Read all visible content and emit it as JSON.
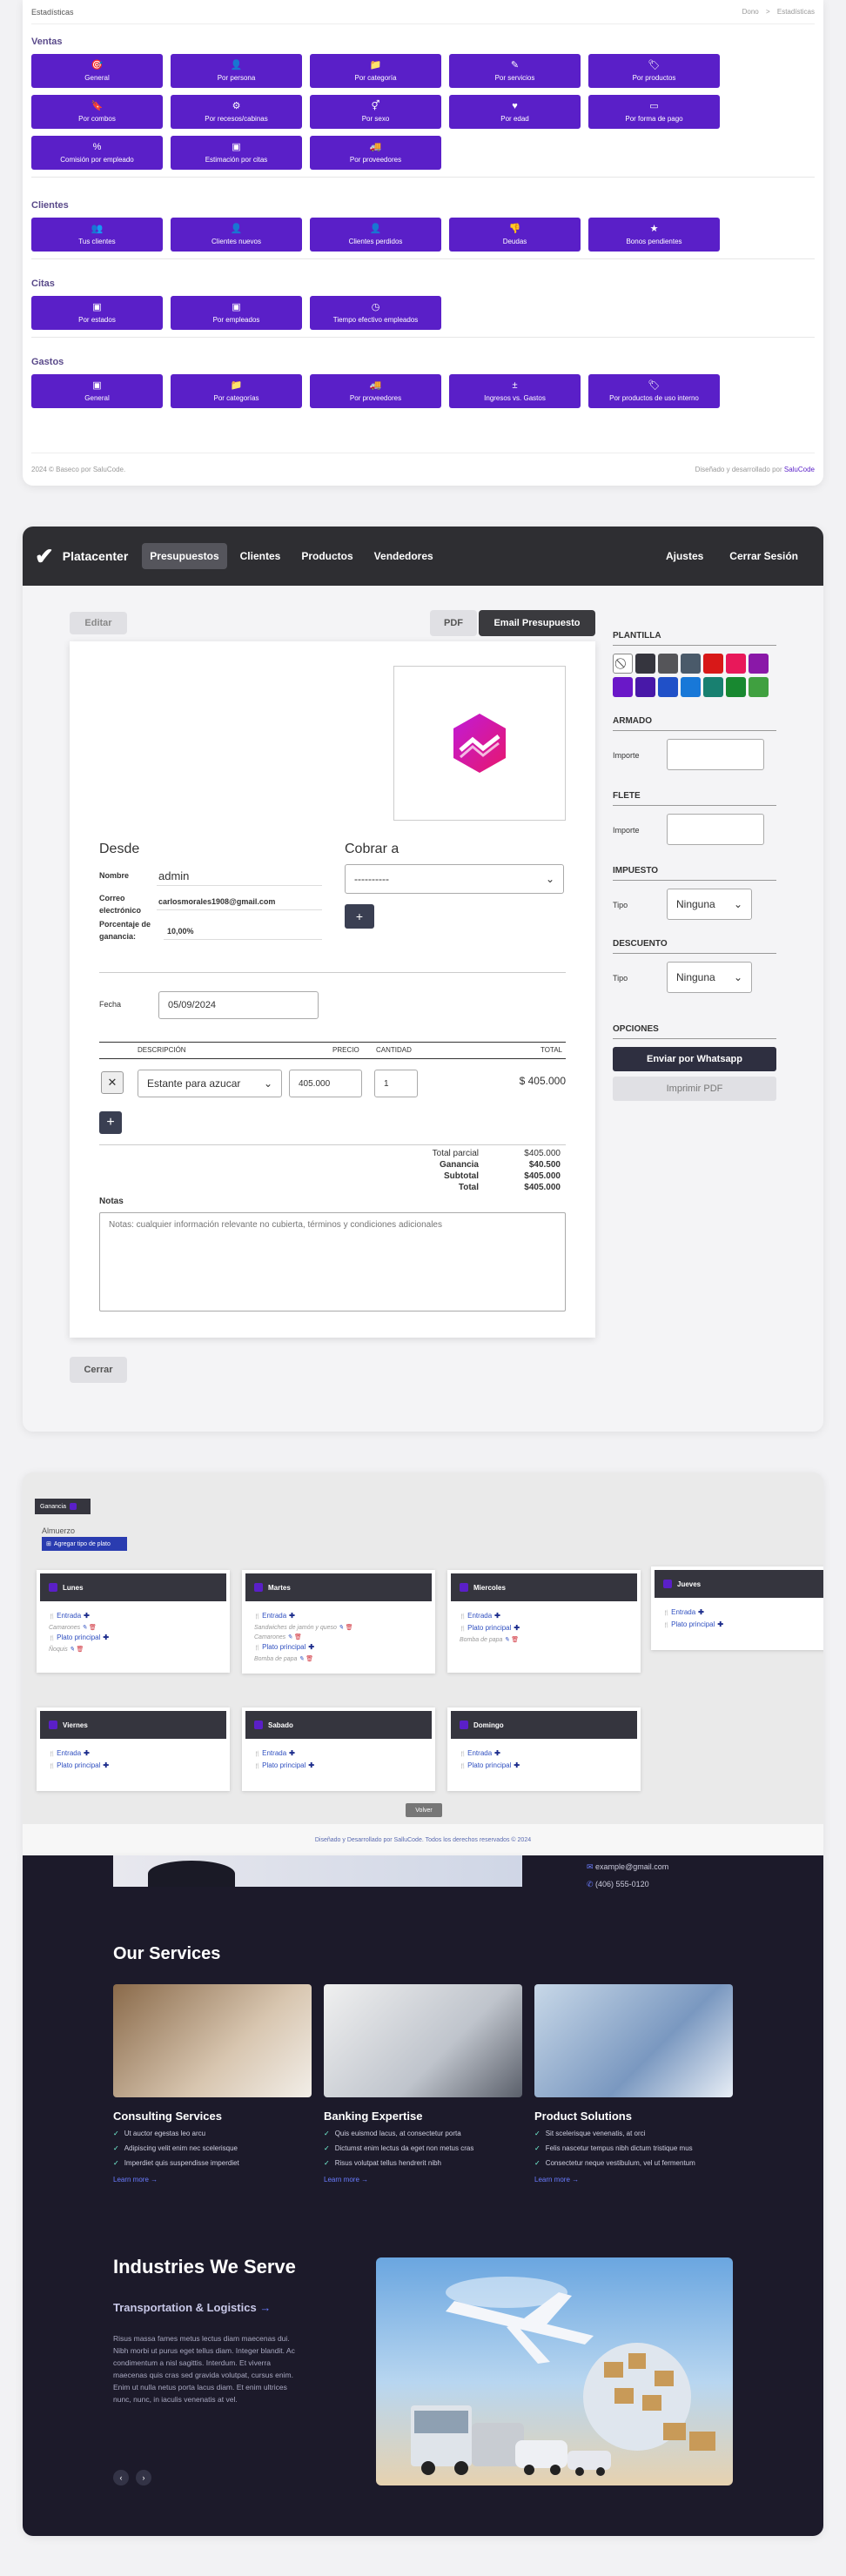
{
  "stats": {
    "title": "Estadísticas",
    "breadcrumb": {
      "home": "Dono",
      "sep": ">",
      "current": "Estadísticas"
    },
    "sections": [
      {
        "title": "Ventas",
        "buttons": [
          {
            "label": "General",
            "icon": "🎯"
          },
          {
            "label": "Por persona",
            "icon": "👤"
          },
          {
            "label": "Por categoría",
            "icon": "📁"
          },
          {
            "label": "Por servicios",
            "icon": "✎"
          },
          {
            "label": "Por productos",
            "icon": "🏷"
          },
          {
            "label": "Por combos",
            "icon": "🔖"
          },
          {
            "label": "Por recesos/cabinas",
            "icon": "⚙"
          },
          {
            "label": "Por sexo",
            "icon": "⚥"
          },
          {
            "label": "Por edad",
            "icon": "♥"
          },
          {
            "label": "Por forma de pago",
            "icon": "▭"
          },
          {
            "label": "Comisión por empleado",
            "icon": "%"
          },
          {
            "label": "Estimación por citas",
            "icon": "▣"
          },
          {
            "label": "Por proveedores",
            "icon": "🚚"
          }
        ]
      },
      {
        "title": "Clientes",
        "buttons": [
          {
            "label": "Tus clientes",
            "icon": "👥"
          },
          {
            "label": "Clientes nuevos",
            "icon": "👤"
          },
          {
            "label": "Clientes perdidos",
            "icon": "👤"
          },
          {
            "label": "Deudas",
            "icon": "👎"
          },
          {
            "label": "Bonos pendientes",
            "icon": "★"
          }
        ]
      },
      {
        "title": "Citas",
        "buttons": [
          {
            "label": "Por estados",
            "icon": "▣"
          },
          {
            "label": "Por empleados",
            "icon": "▣"
          },
          {
            "label": "Tiempo efectivo empleados",
            "icon": "◷"
          }
        ]
      },
      {
        "title": "Gastos",
        "buttons": [
          {
            "label": "General",
            "icon": "▣"
          },
          {
            "label": "Por categorías",
            "icon": "📁"
          },
          {
            "label": "Por proveedores",
            "icon": "🚚"
          },
          {
            "label": "Ingresos vs. Gastos",
            "icon": "±"
          },
          {
            "label": "Por productos de uso interno",
            "icon": "🏷"
          }
        ]
      }
    ],
    "footer_left": "2024 © Baseco por SaluCode.",
    "footer_right": "Diseñado y desarrollado por ",
    "footer_link": "SaluCode"
  },
  "app": {
    "brand": "Platacenter",
    "nav": [
      "Presupuestos",
      "Clientes",
      "Productos",
      "Vendedores"
    ],
    "nav_right": [
      "Ajustes",
      "Cerrar Sesión"
    ],
    "edit_btn": "Editar",
    "pdf_btn": "PDF",
    "email_btn": "Email Presupuesto",
    "close_btn": "Cerrar",
    "doc": {
      "desde": "Desde",
      "cobrar": "Cobrar a",
      "nombre_lbl": "Nombre",
      "nombre_val": "admin",
      "correo_lbl": "Correo electrónico",
      "correo_val": "carlosmorales1908@gmail.com",
      "porc_lbl": "Porcentaje de ganancia:",
      "porc_val": "10,00%",
      "cobrar_select": "----------",
      "fecha_lbl": "Fecha",
      "fecha_val": "05/09/2024",
      "cols": [
        "DESCRIPCIÓN",
        "PRECIO",
        "CANTIDAD",
        "TOTAL"
      ],
      "item": {
        "desc": "Estante para azucar",
        "precio": "405.000",
        "cantidad": "1",
        "total": "$ 405.000"
      },
      "totals": [
        {
          "label": "Total parcial",
          "value": "$405.000",
          "bold": false
        },
        {
          "label": "Ganancia",
          "value": "$40.500",
          "bold": true
        },
        {
          "label": "Subtotal",
          "value": "$405.000",
          "bold": true
        },
        {
          "label": "Total",
          "value": "$405.000",
          "bold": true
        }
      ],
      "notas_lbl": "Notas",
      "notas_ph": "Notas: cualquier información relevante no cubierta, términos y condiciones adicionales"
    },
    "side": {
      "plantilla": "PLANTILLA",
      "colors": [
        "#ffffff",
        "#35353e",
        "#555559",
        "#4a5a6a",
        "#d81818",
        "#e8185a",
        "#8a18a8",
        "#6a18c8",
        "#4818a8",
        "#2050c8",
        "#1878d8",
        "#188070",
        "#188830",
        "#40a040"
      ],
      "armado": "ARMADO",
      "flete": "FLETE",
      "importe": "Importe",
      "impuesto": "IMPUESTO",
      "descuento": "DESCUENTO",
      "tipo": "Tipo",
      "ninguna": "Ninguna",
      "opciones": "OPCIONES",
      "whatsapp": "Enviar por Whatsapp",
      "imprimir": "Imprimir PDF"
    }
  },
  "menu": {
    "ganancia_btn": "Ganancia",
    "almuerzo": "Almuerzo",
    "add_btn": "Agregar tipo de plato",
    "days": [
      {
        "name": "Lunes",
        "rows": [
          [
            "Entrada",
            ""
          ],
          [
            "Camarones",
            "sub"
          ],
          [
            "Plato principal",
            ""
          ],
          [
            "Ñoquis",
            "sub"
          ]
        ]
      },
      {
        "name": "Martes",
        "rows": [
          [
            "Entrada",
            ""
          ],
          [
            "Sandwiches de jamón y queso",
            "sub"
          ],
          [
            "Camarones",
            "sub"
          ],
          [
            "Plato principal",
            ""
          ],
          [
            "Bomba de papa",
            "sub"
          ]
        ]
      },
      {
        "name": "Miercoles",
        "rows": [
          [
            "Entrada",
            ""
          ],
          [
            "Plato principal",
            ""
          ],
          [
            "Bomba de papa",
            "sub"
          ]
        ]
      },
      {
        "name": "Jueves",
        "rows": [
          [
            "Entrada",
            ""
          ],
          [
            "Plato principal",
            ""
          ]
        ]
      },
      {
        "name": "Viernes",
        "rows": [
          [
            "Entrada",
            ""
          ],
          [
            "Plato principal",
            ""
          ]
        ]
      },
      {
        "name": "Sabado",
        "rows": [
          [
            "Entrada",
            ""
          ],
          [
            "Plato principal",
            ""
          ]
        ]
      },
      {
        "name": "Domingo",
        "rows": [
          [
            "Entrada",
            ""
          ],
          [
            "Plato principal",
            ""
          ]
        ]
      }
    ],
    "volver": "Volver",
    "footer": "Diseñado y Desarrollado por SalluCode. Todos los derechos reservados © 2024"
  },
  "site": {
    "email": "example@gmail.com",
    "phone": "(406) 555-0120",
    "services_title": "Our Services",
    "services": [
      {
        "title": "Consulting Services",
        "items": [
          "Ut auctor egestas leo arcu",
          "Adipiscing velit enim nec scelerisque",
          "Imperdiet quis suspendisse imperdiet"
        ],
        "more": "Learn more"
      },
      {
        "title": "Banking Expertise",
        "items": [
          "Quis euismod lacus, at consectetur porta",
          "Dictumst enim lectus da eget non metus cras",
          "Risus volutpat tellus hendrerit nibh"
        ],
        "more": "Learn more"
      },
      {
        "title": "Product Solutions",
        "items": [
          "Sit scelerisque venenatis, at orci",
          "Felis nascetur tempus nibh dictum tristique mus",
          "Consectetur neque vestibulum, vel ut fermentum"
        ],
        "more": "Learn more"
      }
    ],
    "industries_title": "Industries We Serve",
    "industry": "Transportation & Logistics",
    "industry_text": "Risus massa fames metus lectus diam maecenas dui. Nibh morbi ut purus eget tellus diam. Integer blandit. Ac condimentum a nisl sagittis. Interdum. Et viverra maecenas quis cras sed gravida volutpat, cursus enim. Enim ut nulla netus porta lacus diam. Et enim ultrices nunc, nunc, in iaculis venenatis at vel."
  }
}
